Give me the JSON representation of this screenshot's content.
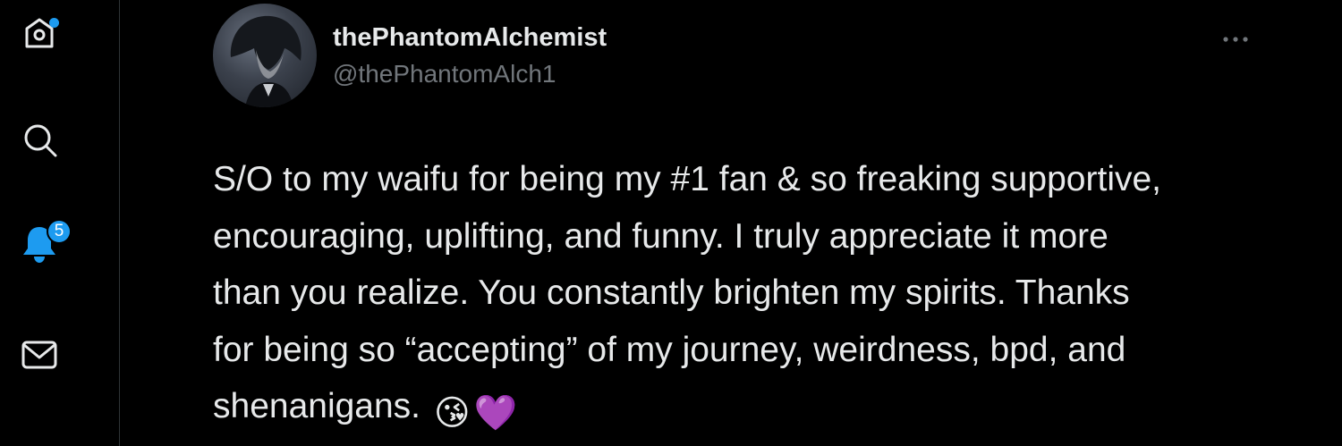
{
  "sidebar": {
    "items": [
      {
        "name": "home",
        "icon": "home-icon",
        "has_dot": true
      },
      {
        "name": "search",
        "icon": "search-icon"
      },
      {
        "name": "notifications",
        "icon": "bell-icon",
        "badge": "5"
      },
      {
        "name": "messages",
        "icon": "mail-icon"
      }
    ],
    "accent": "#1d9bf0"
  },
  "tweet": {
    "author": {
      "display_name": "thePhantomAlchemist",
      "handle": "@thePhantomAlch1"
    },
    "more_icon": "more-icon",
    "text_lines": [
      "S/O to my waifu for being my #1 fan & so freaking supportive,",
      "encouraging, uplifting, and funny. I truly appreciate it more",
      "than you realize. You constantly brighten my spirits. Thanks",
      "for being so “accepting” of my journey, weirdness, bpd, and",
      "shenanigans."
    ],
    "emojis": [
      "😘",
      "💜"
    ]
  },
  "colors": {
    "background": "#000000",
    "text": "#e7e9ea",
    "secondary_text": "#71767b",
    "divider": "#2f3336"
  }
}
